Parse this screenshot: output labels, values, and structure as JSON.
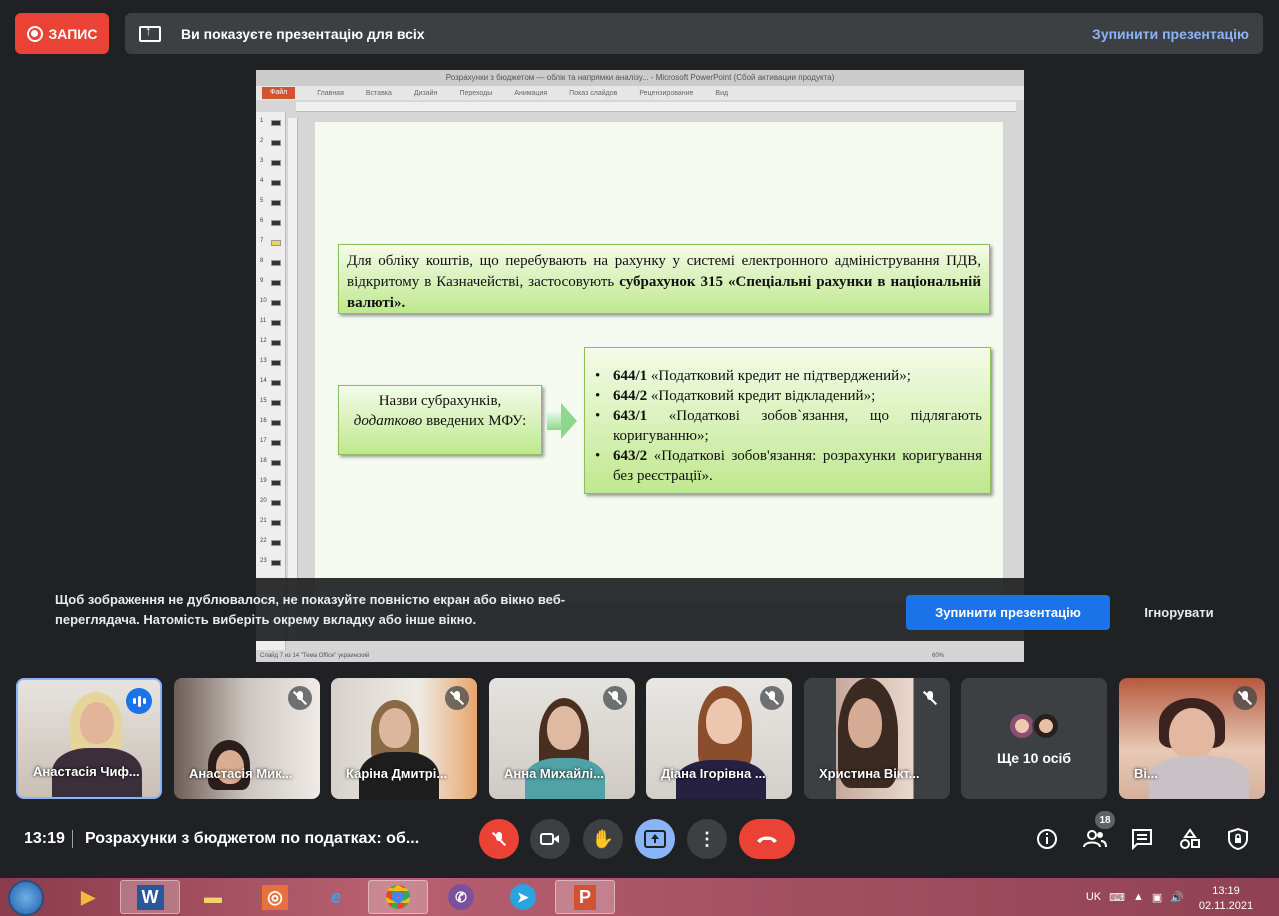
{
  "top_bar": {
    "record_label": "ЗАПИС",
    "presenting_text": "Ви показуєте презентацію для всіх",
    "stop_presenting": "Зупинити презентацію"
  },
  "powerpoint": {
    "window_title": "Розрахунки з бюджетом — облік та напрямки аналізу... - Microsoft PowerPoint (Сбой активации продукта)",
    "tabs": [
      "Файл",
      "Главная",
      "Вставка",
      "Дизайн",
      "Переходы",
      "Анимация",
      "Показ слайдов",
      "Рецензирование",
      "Вид"
    ],
    "status": "Слайд 7 из 14   \"Тема Office\"   украинский",
    "zoom": "60%",
    "thumbnails": [
      "1",
      "2",
      "3",
      "4",
      "5",
      "6",
      "7",
      "8",
      "9",
      "10",
      "11",
      "12",
      "13",
      "14",
      "15",
      "16",
      "17",
      "18",
      "19",
      "20",
      "21",
      "22",
      "23"
    ]
  },
  "slide": {
    "box1_part1": "Для обліку коштів, що перебувають на рахунку у системі електронного адміністрування ПДВ, відкритому в Казначействі, застосовують ",
    "box1_bold": "субрахунок 315 «Спеціальні рахунки в національній валюті».",
    "box2_line1": "Назви субрахунків,",
    "box2_italic": "додатково",
    "box2_line2": " введених МФУ:",
    "items": [
      {
        "code": "644/1",
        "text": " «Податковий кредит не підтверджений»;"
      },
      {
        "code": "644/2",
        "text": " «Податковий кредит відкладений»;"
      },
      {
        "code": "643/1",
        "text": " «Податкові зобов`язання, що підлягають коригуванню»;"
      },
      {
        "code": "643/2",
        "text": " «Податкові зобов'язання: розрахунки коригування без реєстрації»."
      }
    ]
  },
  "warning": {
    "text": "Щоб зображення не дублювалося, не показуйте повністю екран або вікно веб-переглядача. Натомість виберіть окрему вкладку або інше вікно.",
    "stop_button": "Зупинити презентацію",
    "ignore_button": "Ігнорувати"
  },
  "participants": [
    {
      "name": "Анастасія Чиф...",
      "speaking": true
    },
    {
      "name": "Анастасія Мик...",
      "speaking": false
    },
    {
      "name": "Каріна Дмитрі...",
      "speaking": false
    },
    {
      "name": "Анна Михайлі...",
      "speaking": false
    },
    {
      "name": "Діана Ігорівна ...",
      "speaking": false
    },
    {
      "name": "Христина Вікт...",
      "speaking": false
    },
    {
      "name": "Ще 10 осіб",
      "speaking": false
    },
    {
      "name": "Ві...",
      "speaking": false
    }
  ],
  "bottom_bar": {
    "time": "13:19",
    "meeting_title": "Розрахунки з бюджетом по податках: об...",
    "participants_count": "18"
  },
  "taskbar": {
    "language": "UK",
    "clock_time": "13:19",
    "clock_date": "02.11.2021"
  },
  "colors": {
    "accent_red": "#ea4335",
    "accent_blue": "#1a73e8",
    "meet_bg": "#202124",
    "slide_box_green": "#bfe88f"
  }
}
